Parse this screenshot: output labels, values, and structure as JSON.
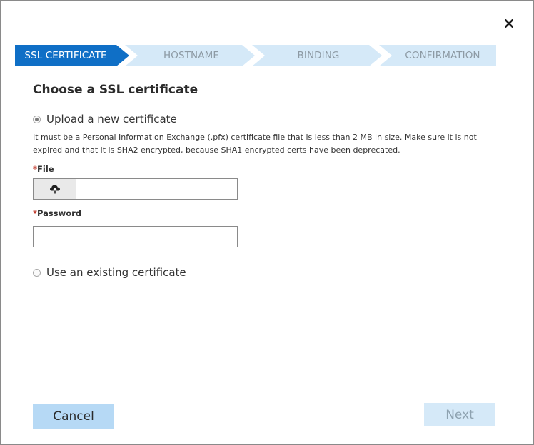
{
  "dialog": {
    "close_icon": "close-icon"
  },
  "steps": [
    {
      "label": "SSL CERTIFICATE",
      "state": "active"
    },
    {
      "label": "HOSTNAME",
      "state": "inactive"
    },
    {
      "label": "BINDING",
      "state": "inactive"
    },
    {
      "label": "CONFIRMATION",
      "state": "inactive"
    }
  ],
  "colors": {
    "step_active_bg": "#0f6fc6",
    "step_active_text": "#ffffff",
    "step_inactive_bg": "#d5e9f8",
    "step_inactive_text": "#8d9aa4",
    "required_marker": "#c0392b",
    "button_primary_bg": "#b6d9f5",
    "button_disabled_bg": "#d5e9f8"
  },
  "form": {
    "title": "Choose a SSL certificate",
    "option_upload": {
      "label": "Upload a new certificate",
      "selected": true
    },
    "help_text": "It must be a Personal Information Exchange (.pfx) certificate file that is less than 2 MB in size. Make sure it is not expired and that it is SHA2 encrypted, because SHA1 encrypted certs have been deprecated.",
    "file": {
      "required_mark": "*",
      "label": "File",
      "value": "",
      "browse_icon": "cloud-upload-icon"
    },
    "password": {
      "required_mark": "*",
      "label": "Password",
      "value": ""
    },
    "option_existing": {
      "label": "Use an existing certificate",
      "selected": false
    }
  },
  "footer": {
    "cancel_label": "Cancel",
    "next_label": "Next",
    "next_disabled": true
  }
}
